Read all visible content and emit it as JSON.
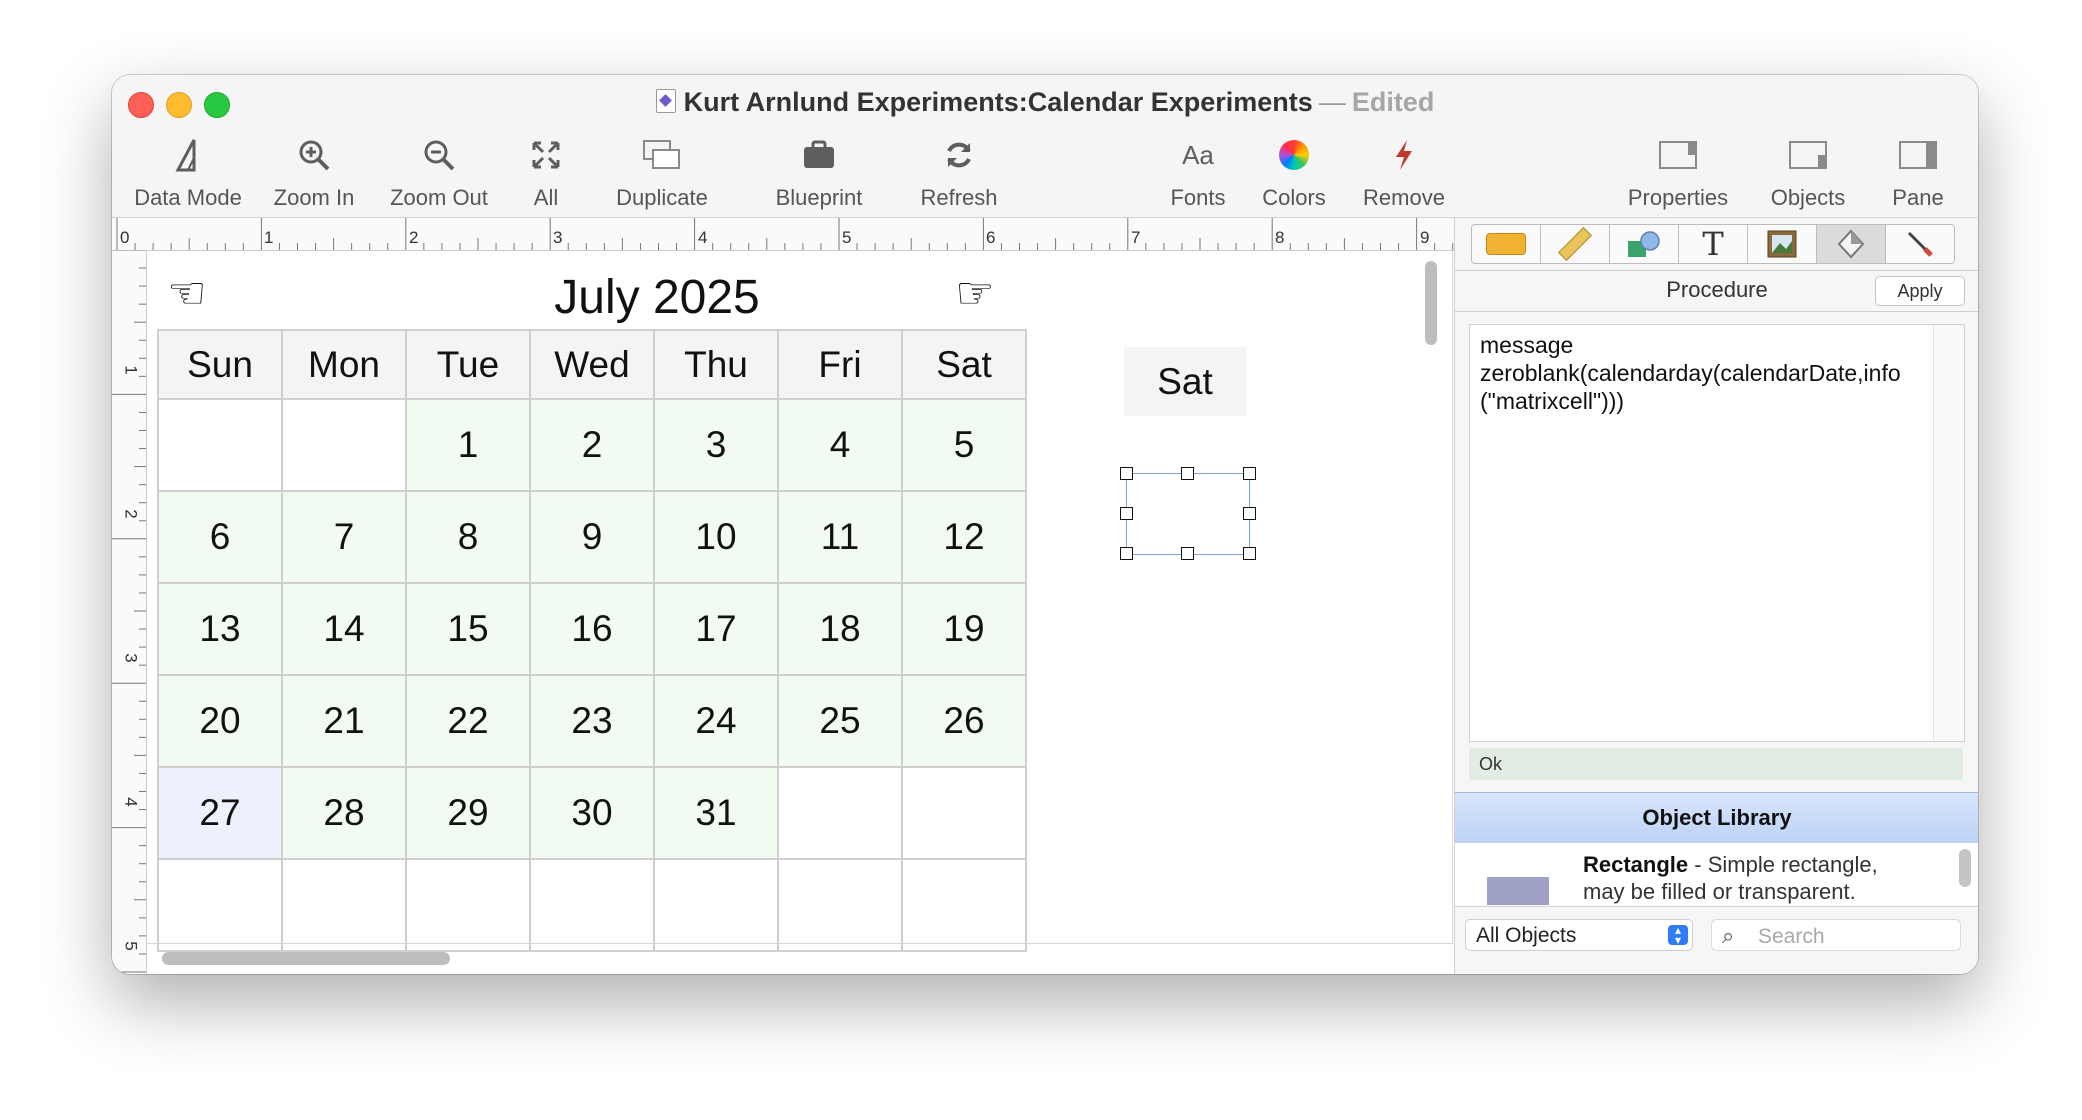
{
  "window": {
    "title": "Kurt Arnlund Experiments:Calendar Experiments",
    "separator": "—",
    "edited": "Edited"
  },
  "toolbar": {
    "data_mode": "Data Mode",
    "zoom_in": "Zoom In",
    "zoom_out": "Zoom Out",
    "all": "All",
    "duplicate": "Duplicate",
    "blueprint": "Blueprint",
    "refresh": "Refresh",
    "fonts": "Fonts",
    "fonts_glyph": "Aa",
    "colors": "Colors",
    "remove": "Remove",
    "properties": "Properties",
    "objects": "Objects",
    "pane": "Pane"
  },
  "ruler": {
    "top": [
      "0",
      "1",
      "2",
      "3",
      "4",
      "5",
      "6",
      "7",
      "8",
      "9"
    ],
    "left": [
      "1",
      "2",
      "3",
      "4",
      "5"
    ]
  },
  "calendar": {
    "title": "July 2025",
    "days": [
      "Sun",
      "Mon",
      "Tue",
      "Wed",
      "Thu",
      "Fri",
      "Sat"
    ],
    "weeks": [
      [
        "",
        "",
        "1",
        "2",
        "3",
        "4",
        "5"
      ],
      [
        "6",
        "7",
        "8",
        "9",
        "10",
        "11",
        "12"
      ],
      [
        "13",
        "14",
        "15",
        "16",
        "17",
        "18",
        "19"
      ],
      [
        "20",
        "21",
        "22",
        "23",
        "24",
        "25",
        "26"
      ],
      [
        "27",
        "28",
        "29",
        "30",
        "31",
        "",
        ""
      ],
      [
        "",
        "",
        "",
        "",
        "",
        "",
        ""
      ]
    ],
    "floating_day": "Sat"
  },
  "panel": {
    "procedure_label": "Procedure",
    "apply": "Apply",
    "procedure_code": "message\nzeroblank(calendarday(calendarDate,info(\"matrixcell\")))",
    "status": "Ok",
    "library_title": "Object Library",
    "library_item": {
      "name": "Rectangle",
      "description": " - Simple rectangle, may be filled or transparent."
    },
    "filter_value": "All Objects",
    "search_placeholder": "Search"
  },
  "colors": {
    "accent": "#2f7cf6",
    "cell_fill": "#f2fbf2",
    "today_fill": "#eff0fd",
    "library_header": "#bcd2f7",
    "remove_icon": "#c0392b"
  }
}
